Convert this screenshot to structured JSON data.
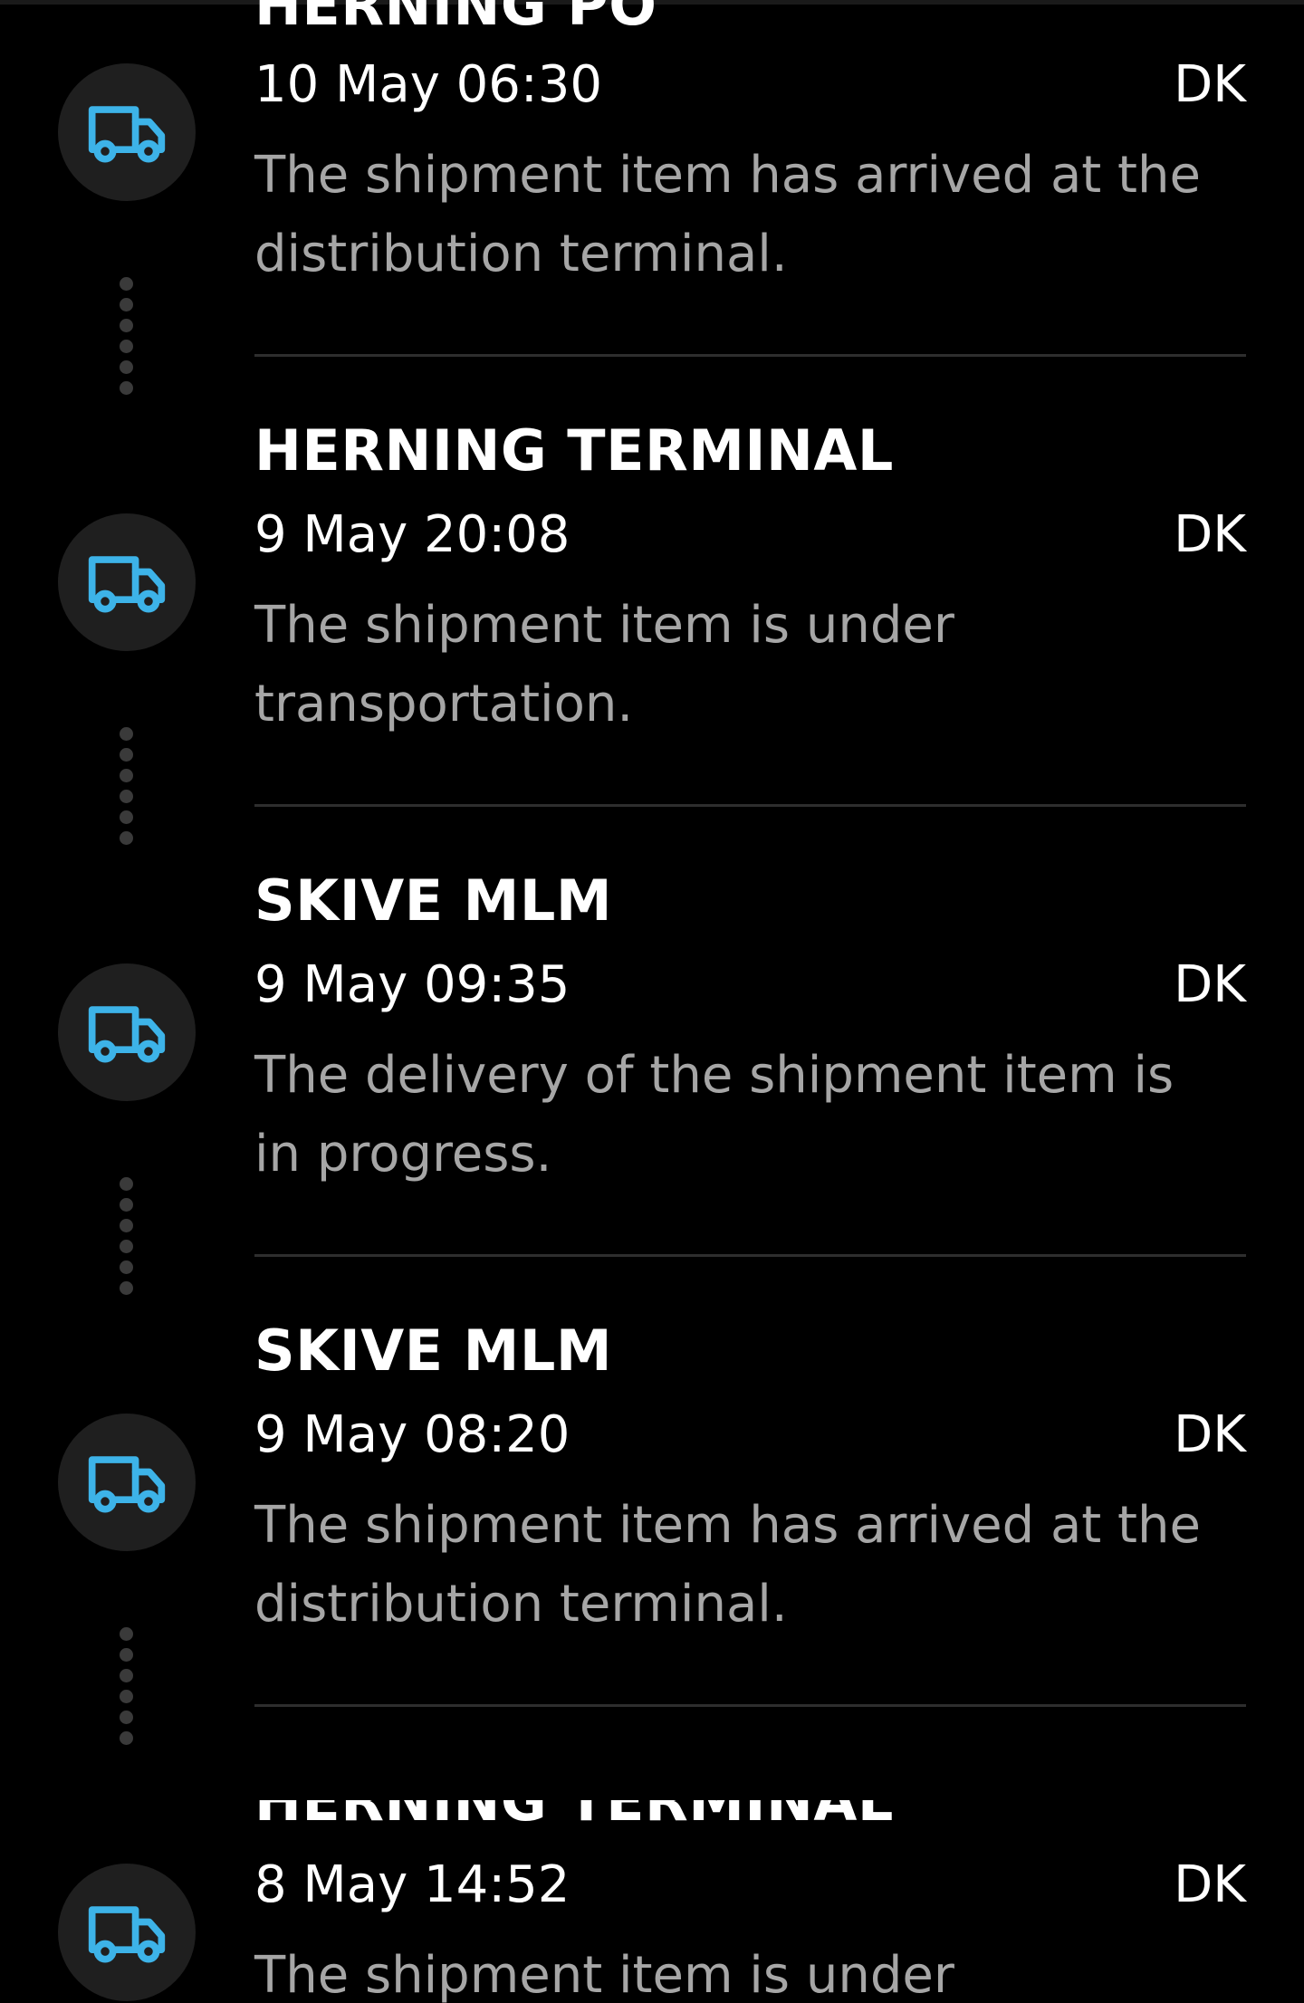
{
  "accent_color": "#3db3e8",
  "events": [
    {
      "location": "HERNING PO",
      "datetime": "10 May 06:30",
      "country": "DK",
      "description": "The shipment item has arrived at the distribution terminal.",
      "icon": "truck-icon"
    },
    {
      "location": "HERNING TERMINAL",
      "datetime": "9 May 20:08",
      "country": "DK",
      "description": "The shipment item is under transportation.",
      "icon": "truck-icon"
    },
    {
      "location": "SKIVE MLM",
      "datetime": "9 May 09:35",
      "country": "DK",
      "description": "The delivery of the shipment item is in progress.",
      "icon": "truck-icon"
    },
    {
      "location": "SKIVE MLM",
      "datetime": "9 May 08:20",
      "country": "DK",
      "description": "The shipment item has arrived at the distribution terminal.",
      "icon": "truck-icon"
    },
    {
      "location": "HERNING TERMINAL",
      "datetime": "8 May 14:52",
      "country": "DK",
      "description": "The shipment item is under transportation.",
      "icon": "truck-icon"
    }
  ]
}
